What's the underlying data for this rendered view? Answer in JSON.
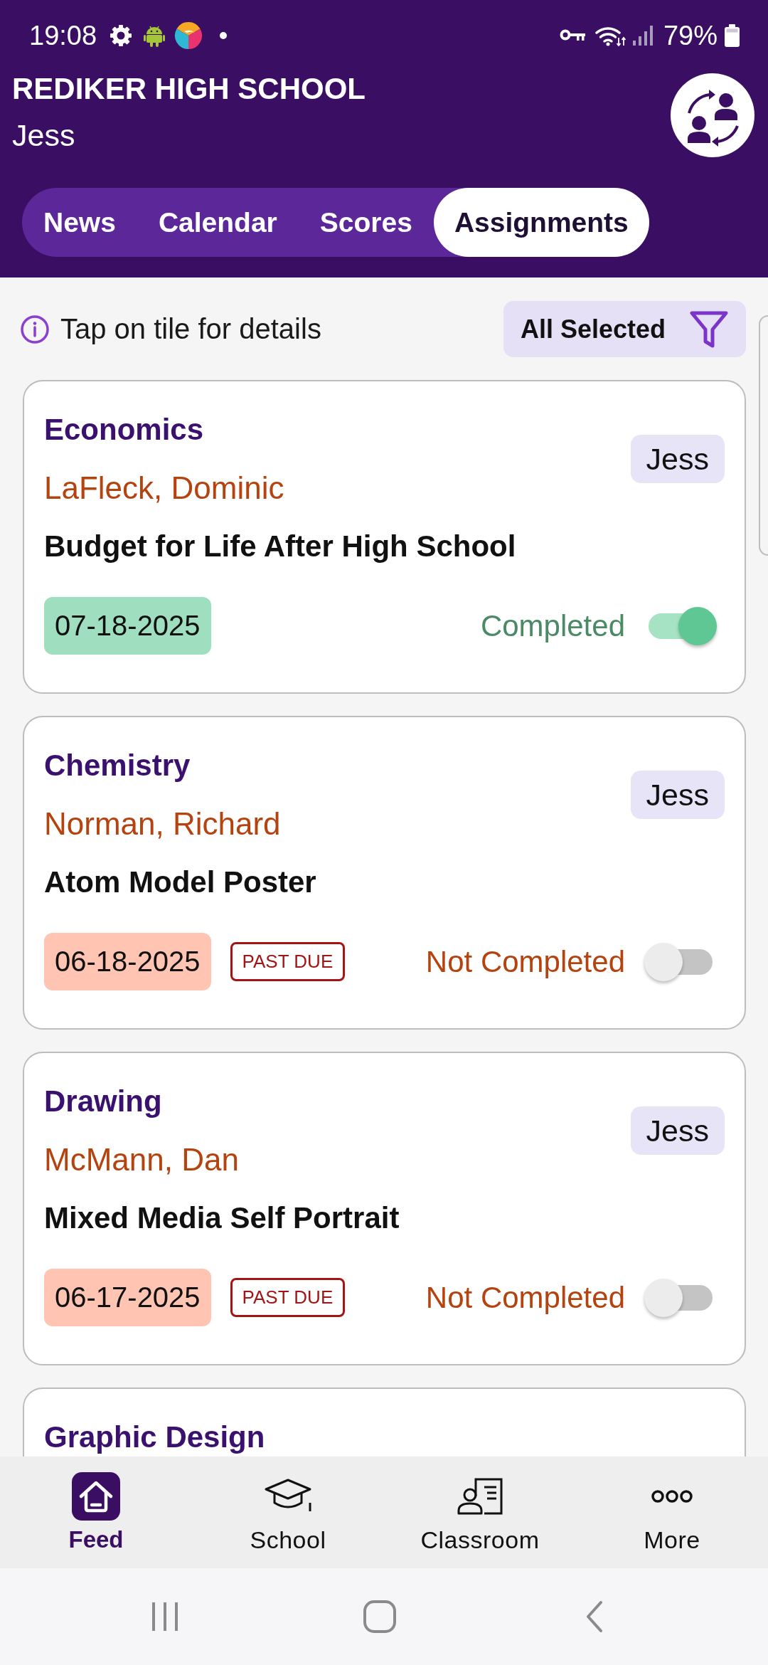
{
  "status_bar": {
    "time": "19:08",
    "battery": "79%"
  },
  "header": {
    "school": "REDIKER HIGH SCHOOL",
    "student": "Jess"
  },
  "tabs": [
    {
      "label": "News",
      "selected": false
    },
    {
      "label": "Calendar",
      "selected": false
    },
    {
      "label": "Scores",
      "selected": false
    },
    {
      "label": "Assignments",
      "selected": true
    }
  ],
  "hint": "Tap on tile for details",
  "filter": {
    "label": "All Selected"
  },
  "assignments": [
    {
      "subject": "Economics",
      "teacher": "LaFleck, Dominic",
      "title": "Budget for Life After High School",
      "student": "Jess",
      "due_date": "07-18-2025",
      "status": "Completed",
      "completed": true
    },
    {
      "subject": "Chemistry",
      "teacher": "Norman, Richard",
      "title": "Atom Model Poster",
      "student": "Jess",
      "due_date": "06-18-2025",
      "past_due_label": "PAST DUE",
      "status": "Not Completed",
      "completed": false
    },
    {
      "subject": "Drawing",
      "teacher": "McMann, Dan",
      "title": "Mixed Media Self Portrait",
      "student": "Jess",
      "due_date": "06-17-2025",
      "past_due_label": "PAST DUE",
      "status": "Not Completed",
      "completed": false
    },
    {
      "subject": "Graphic Design"
    }
  ],
  "bottom_nav": [
    {
      "label": "Feed",
      "kind": "feed",
      "selected": true
    },
    {
      "label": "School",
      "kind": "school",
      "selected": false
    },
    {
      "label": "Classroom",
      "kind": "classroom",
      "selected": false
    },
    {
      "label": "More",
      "kind": "more",
      "selected": false
    }
  ]
}
